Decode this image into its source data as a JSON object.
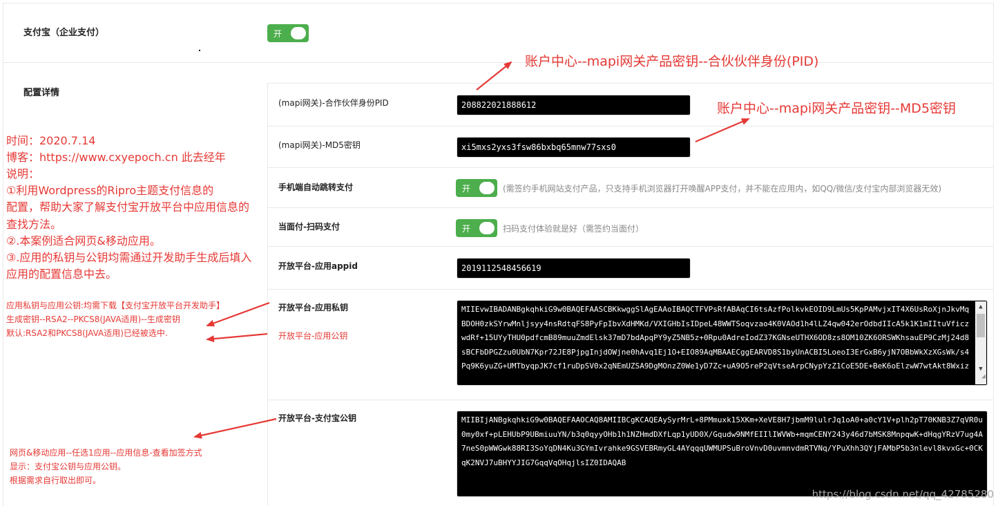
{
  "alipay": {
    "title": "支付宝（企业支付）",
    "toggle_label": "开"
  },
  "config": {
    "title": "配置详情"
  },
  "rows": {
    "pid": {
      "label": "(mapi网关)-合作伙伴身份PID",
      "value": "208822021888612"
    },
    "md5": {
      "label": "(mapi网关)-MD5密钥",
      "value": "xi5mxs2yxs3fsw86bxbq65mnw77sxs0"
    },
    "mobile_jump": {
      "label": "手机端自动跳转支付",
      "toggle_label": "开",
      "hint": "(需签约手机网站支付产品，只支持手机浏览器打开唤醒APP支付，并不能在应用内，如QQ/微信/支付宝内部浏览器无效)"
    },
    "f2f": {
      "label": "当面付-扫码支付",
      "toggle_label": "开",
      "hint": "扫码支付体验就是好（需签约当面付）"
    },
    "appid": {
      "label": "开放平台-应用appid",
      "value": "2019112548456619"
    },
    "private_key": {
      "label": "开放平台-应用私钥",
      "sub_label": "开放平台-应用公钥",
      "value": "MIIEvwIBADANBgkqhkiG9w0BAQEFAASCBKkwggSlAgEAAoIBAQCTFVPsRfABAqCI6tsAzfPolkvkEOID9LmUs5KpPAMvjxIT4X6UsRoXjnJkvMqBDOH0zkSYrwMnljsyy4nsRdtqFS8PyFpIbvXdHMKd/VXIGHbIsIDpeL48WWTSoqvzao4K0VAOd1h4lLZ4qw042erOdbdIIcA5k1K1mIItuVficzwdRf+15UYyTHU0pdfcmB89muuZmdElsk37mD7bdApqPY9yZ5NB5z+0Rpu0AdreIodZ37KGNseUTHX6OD8zs8OM10ZK6ORSWKhsauEP9CzMj24d8sBCFbDPGZzu0UbN7Kpr72JE8PjpgInjdOWjne0hAvq1Ej1O+EIO89AqMBAAECggEARVD8S1byUnACBI5LoeoI3ErGxB6yjN7OBbWkXzXGsWk/s4Pq9K6yuZG+UMTbyqpJK7cf1ruDpSV0x2qNEmUZSA9DgMOnzZ0We1yD7Zc+uA9O5reP2qVtseArpCNypYzZ1CoE5DE+BeK6oElzwW7wtAkt8Wxiz"
    },
    "alipay_public_key": {
      "label": "开放平台-支付宝公钥",
      "value": "MIIBIjANBgkqhkiG9w0BAQEFAAOCAQ8AMIIBCgKCAQEAySyrMrL+8PMmuxk15XKm+XeVE8H7jbmM9lulrJq1oA0+a0cY1V+plh2pT70KNB3Z7qVR0u0my0xf+pLEHUbP9UBmiuuYN/b3q0qyyOHb1h1NZHmdDXfLqp1yUD0X/Gqudw9NMfEIIlIWVWb+mqmCENY243y46d7bMSK8MnpqwK+dHqgYRzV7ug4A7neS0pWWGwk88RI3SoYqDN4Ku3GYmIvrahke9GSVEBRmyGL4AYqqqUWMUPSuBroVnvD0uvmnvdmRTVNq/YPuXhh3QYjFAMbP5b3nlevl8kvxGc+0CKqK2NVJ7uBHYYJIG7GqqVqOHqjlsIZ0IDAQAB"
    }
  },
  "annotations": {
    "pid_path": "账户中心--mapi网关产品密钥--合伙伙伴身份(PID)",
    "md5_path": "账户中心--mapi网关产品密钥--MD5密钥",
    "notes": [
      "时间：2020.7.14",
      "博客：https://www.cxyepoch.cn 此去经年",
      "说明：",
      "①利用Wordpress的Ripro主题支付信息的",
      "配置，帮助大家了解支付宝开放平台中应用信息的",
      "查找方法。",
      "②.本案例适合网页&移动应用。",
      "③.应用的私钥与公钥均需通过开发助手生成后填入",
      "应用的配置信息中去。"
    ],
    "key_notes": [
      "应用私钥与应用公钥:均需下载【支付宝开放平台开发助手】",
      "生成密钥--RSA2--PKCS8(JAVA适用)--生成密钥",
      "默认:RSA2和PKCS8(JAVA适用)已经被选中."
    ],
    "pubkey_notes": [
      "网页&移动应用--任选1应用--应用信息-查看加签方式",
      "显示：支付宝公钥与应用公钥。",
      "根据需求自行取出即可。"
    ]
  },
  "watermark": "https://blog.csdn.net/qq_42785280",
  "colors": {
    "toggle_green": "#4cae4c",
    "annotation_red": "#e53935"
  }
}
